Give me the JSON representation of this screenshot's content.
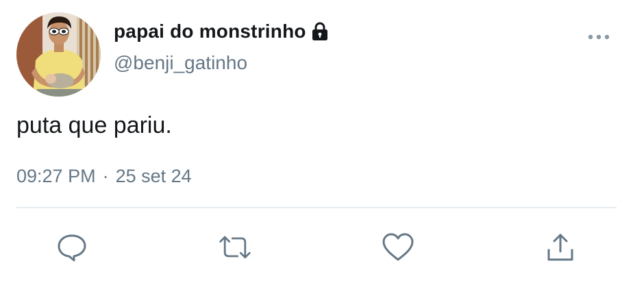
{
  "user": {
    "display_name": "papai do monstrinho",
    "handle": "@benji_gatinho",
    "avatar_icon": "avatar-photo",
    "protected_icon": "lock-icon"
  },
  "tweet": {
    "text": "puta que pariu.",
    "time": "09:27 PM",
    "separator": "·",
    "date": "25 set 24"
  },
  "actions": {
    "reply_icon": "reply-icon",
    "retweet_icon": "retweet-icon",
    "like_icon": "heart-icon",
    "share_icon": "share-icon",
    "more_icon": "more-icon"
  },
  "colors": {
    "text_primary": "#14171a",
    "text_secondary": "#657786",
    "divider": "#e6ecf0"
  }
}
